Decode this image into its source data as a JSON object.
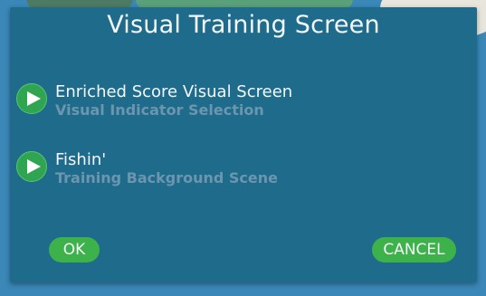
{
  "dialog": {
    "title": "Visual Training Screen"
  },
  "options": [
    {
      "icon": "play-icon",
      "title": "Enriched Score Visual Screen",
      "subtitle": "Visual Indicator Selection"
    },
    {
      "icon": "play-icon",
      "title": "Fishin'",
      "subtitle": "Training Background Scene"
    }
  ],
  "buttons": {
    "ok_label": "OK",
    "cancel_label": "CANCEL"
  },
  "colors": {
    "dialog_bg": "#1f6b8c",
    "accent_green": "#3db14a",
    "subtitle_text": "#6c96ad"
  }
}
